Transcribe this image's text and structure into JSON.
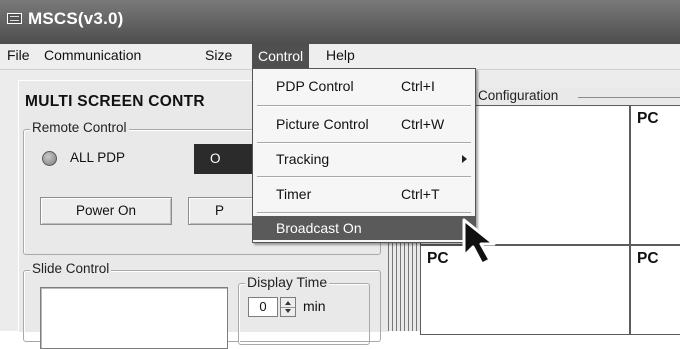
{
  "window": {
    "title": "MSCS(v3.0)"
  },
  "menubar": {
    "items": [
      "File",
      "Communication",
      "Size",
      "Control",
      "Help"
    ],
    "active": "Control"
  },
  "control_menu": {
    "items": [
      {
        "label": "PDP Control",
        "shortcut": "Ctrl+I"
      },
      {
        "label": "Picture Control",
        "shortcut": "Ctrl+W"
      },
      {
        "label": "Tracking",
        "shortcut": "",
        "submenu": true
      },
      {
        "label": "Timer",
        "shortcut": "Ctrl+T"
      },
      {
        "label": "Broadcast On",
        "shortcut": "",
        "highlighted": true
      }
    ]
  },
  "left_panel": {
    "heading": "MULTI SCREEN CONTR",
    "remote_control": {
      "group_label": "Remote Control",
      "all_pdp_label": "ALL PDP",
      "dark_button_label": "O",
      "power_on_label": "Power On",
      "second_button_label": "P"
    },
    "slide_control": {
      "group_label": "Slide Control",
      "display_time": {
        "label": "Display Time",
        "value": "0",
        "unit": "min"
      }
    }
  },
  "right_panel": {
    "config_label": "Configuration",
    "cells": [
      "PC",
      "PC",
      "PC"
    ]
  },
  "colors": {
    "titlebar": "#5e5e5e",
    "menu_highlight": "#4f4f4f",
    "dark_button": "#2b2b2b"
  },
  "icons": [
    "app-window-icon",
    "radio-indicator-icon",
    "spin-up-icon",
    "spin-down-icon",
    "submenu-arrow-icon",
    "mouse-pointer-icon"
  ]
}
